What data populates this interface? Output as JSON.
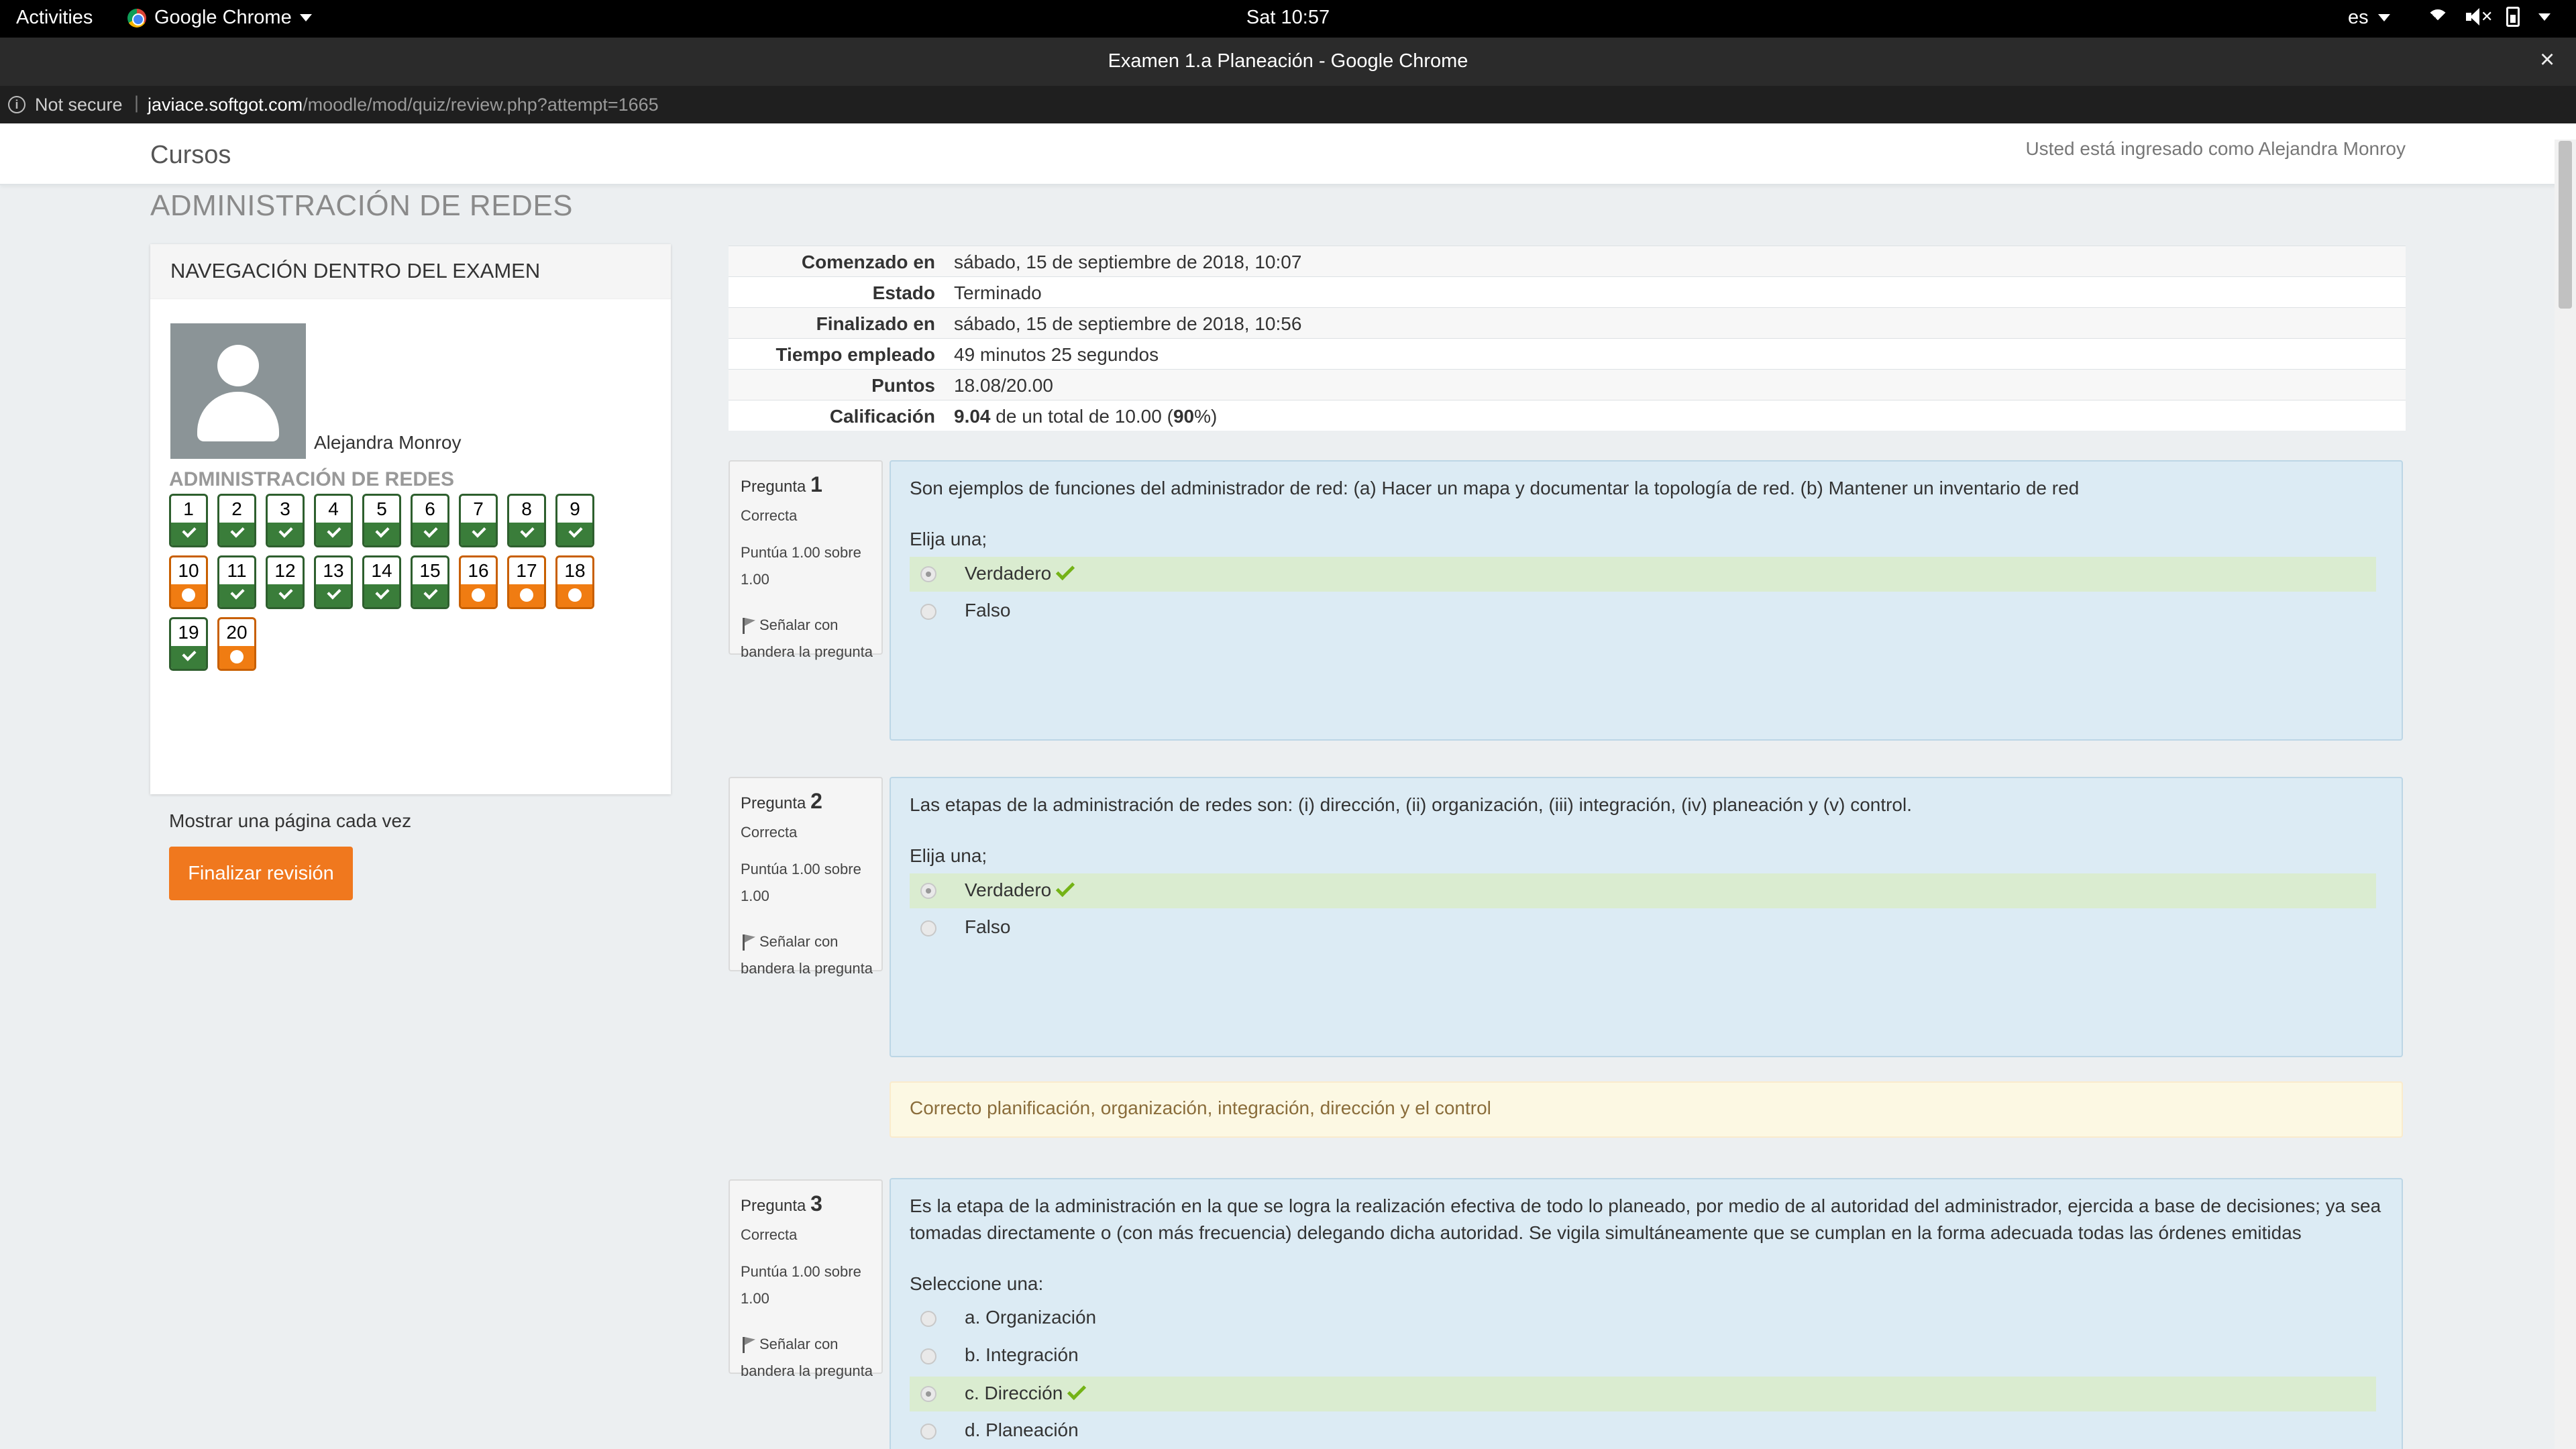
{
  "system_bar": {
    "activities": "Activities",
    "app_name": "Google Chrome",
    "clock": "Sat 10:57",
    "language": "es"
  },
  "browser": {
    "window_title": "Examen 1.a Planeación - Google Chrome",
    "security_label": "Not secure",
    "url_host": "javiace.softgot.com",
    "url_path": "/moodle/mod/quiz/review.php?attempt=1665"
  },
  "navbar": {
    "brand": "Cursos",
    "logged_in_text": "Usted está ingresado como Alejandra Monroy"
  },
  "course_title": "ADMINISTRACIÓN DE REDES",
  "quiz_nav": {
    "heading": "NAVEGACIÓN DENTRO DEL EXAMEN",
    "user_name": "Alejandra Monroy",
    "course": "ADMINISTRACIÓN DE REDES",
    "questions": [
      {
        "n": "1",
        "status": "correct"
      },
      {
        "n": "2",
        "status": "correct"
      },
      {
        "n": "3",
        "status": "correct"
      },
      {
        "n": "4",
        "status": "correct"
      },
      {
        "n": "5",
        "status": "correct"
      },
      {
        "n": "6",
        "status": "correct"
      },
      {
        "n": "7",
        "status": "correct"
      },
      {
        "n": "8",
        "status": "correct"
      },
      {
        "n": "9",
        "status": "correct"
      },
      {
        "n": "10",
        "status": "partial"
      },
      {
        "n": "11",
        "status": "correct"
      },
      {
        "n": "12",
        "status": "correct"
      },
      {
        "n": "13",
        "status": "correct"
      },
      {
        "n": "14",
        "status": "correct"
      },
      {
        "n": "15",
        "status": "correct"
      },
      {
        "n": "16",
        "status": "partial"
      },
      {
        "n": "17",
        "status": "partial"
      },
      {
        "n": "18",
        "status": "partial"
      },
      {
        "n": "19",
        "status": "correct"
      },
      {
        "n": "20",
        "status": "partial"
      }
    ],
    "show_one_page": "Mostrar una página cada vez",
    "finish_button": "Finalizar revisión"
  },
  "summary": {
    "started_label": "Comenzado en",
    "started_value": "sábado, 15 de septiembre de 2018, 10:07",
    "state_label": "Estado",
    "state_value": "Terminado",
    "finished_label": "Finalizado en",
    "finished_value": "sábado, 15 de septiembre de 2018, 10:56",
    "time_label": "Tiempo empleado",
    "time_value": "49 minutos 25 segundos",
    "points_label": "Puntos",
    "points_value": "18.08/20.00",
    "grade_label": "Calificación",
    "grade_score": "9.04",
    "grade_middle": " de un total de 10.00 (",
    "grade_percent": "90",
    "grade_end": "%)"
  },
  "questions": [
    {
      "label": "Pregunta",
      "number": "1",
      "state": "Correcta",
      "grade": "Puntúa 1.00 sobre 1.00",
      "flag": "Señalar con bandera la pregunta",
      "text": "Son ejemplos de funciones del administrador de red: (a) Hacer un mapa y documentar la topología de red. (b) Mantener un inventario de red",
      "prompt": "Elija una;",
      "options": [
        "Verdadero",
        "Falso"
      ]
    },
    {
      "label": "Pregunta",
      "number": "2",
      "state": "Correcta",
      "grade": "Puntúa 1.00 sobre 1.00",
      "flag": "Señalar con bandera la pregunta",
      "text": "Las etapas de la administración de redes son: (i) dirección, (ii) organización, (iii) integración, (iv) planeación y (v) control.",
      "prompt": "Elija una;",
      "options": [
        "Verdadero",
        "Falso"
      ],
      "feedback": "Correcto planificación, organización, integración, dirección y el control"
    },
    {
      "label": "Pregunta",
      "number": "3",
      "state": "Correcta",
      "grade": "Puntúa 1.00 sobre 1.00",
      "flag": "Señalar con bandera la pregunta",
      "text": "Es la etapa de la administración en la que se logra la realización efectiva de todo lo planeado, por medio de al autoridad del administrador, ejercida a base de decisiones; ya sea tomadas directamente o (con más frecuencia) delegando dicha autoridad. Se vigila simultáneamente que se cumplan en la forma adecuada todas las órdenes emitidas",
      "prompt": "Seleccione una:",
      "options": [
        "a. Organización",
        "b. Integración",
        "c. Dirección",
        "d. Planeación"
      ]
    }
  ],
  "colors": {
    "correct": "#3a7d3a",
    "partial": "#f07c12",
    "finish_button": "#f0781e",
    "question_bg": "#dcebf4",
    "correct_option_bg": "#daecd0",
    "feedback_bg": "#fcf8e3"
  },
  "icons": [
    "chrome-logo-icon",
    "wifi-icon",
    "volume-muted-icon",
    "battery-icon",
    "info-icon",
    "user-avatar-icon",
    "flag-icon",
    "check-icon",
    "close-icon"
  ]
}
